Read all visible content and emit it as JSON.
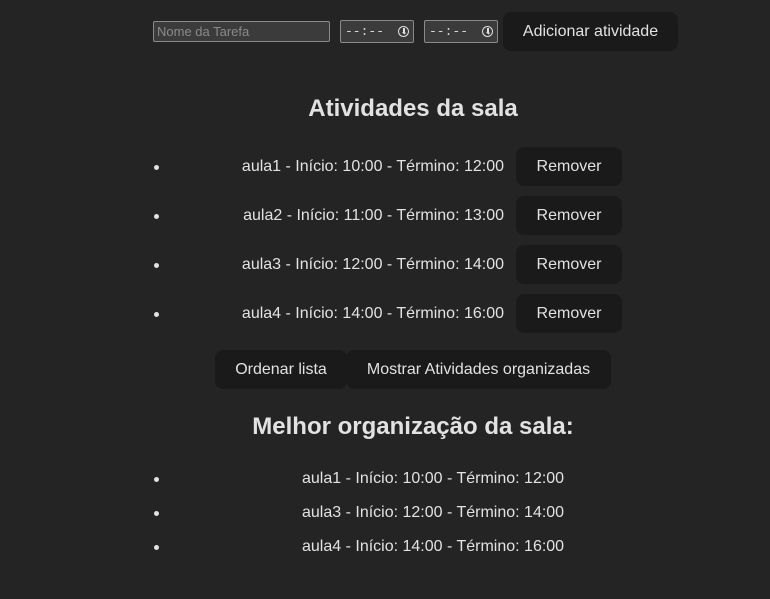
{
  "form": {
    "task_placeholder": "Nome da Tarefa",
    "start_time_placeholder": "--:--",
    "end_time_placeholder": "--:--",
    "add_button_label": "Adicionar atividade"
  },
  "activities": {
    "title": "Atividades da sala",
    "items": [
      {
        "text": "aula1 - Início: 10:00 - Término: 12:00",
        "remove_label": "Remover"
      },
      {
        "text": "aula2 - Início: 11:00 - Término: 13:00",
        "remove_label": "Remover"
      },
      {
        "text": "aula3 - Início: 12:00 - Término: 14:00",
        "remove_label": "Remover"
      },
      {
        "text": "aula4 - Início: 14:00 - Término: 16:00",
        "remove_label": "Remover"
      }
    ]
  },
  "actions": {
    "sort_label": "Ordenar lista",
    "show_label": "Mostrar Atividades organizadas"
  },
  "best": {
    "title": "Melhor organização da sala:",
    "items": [
      "aula1 - Início: 10:00 - Término: 12:00",
      "aula3 - Início: 12:00 - Término: 14:00",
      "aula4 - Início: 14:00 - Término: 16:00"
    ]
  },
  "icons": {
    "time_picker": "clock-icon",
    "bullet": "bullet-dot"
  },
  "colors": {
    "background": "#242424",
    "button_bg": "#1a1a1a",
    "input_bg": "#3b3b3b",
    "text": "#dedede"
  }
}
